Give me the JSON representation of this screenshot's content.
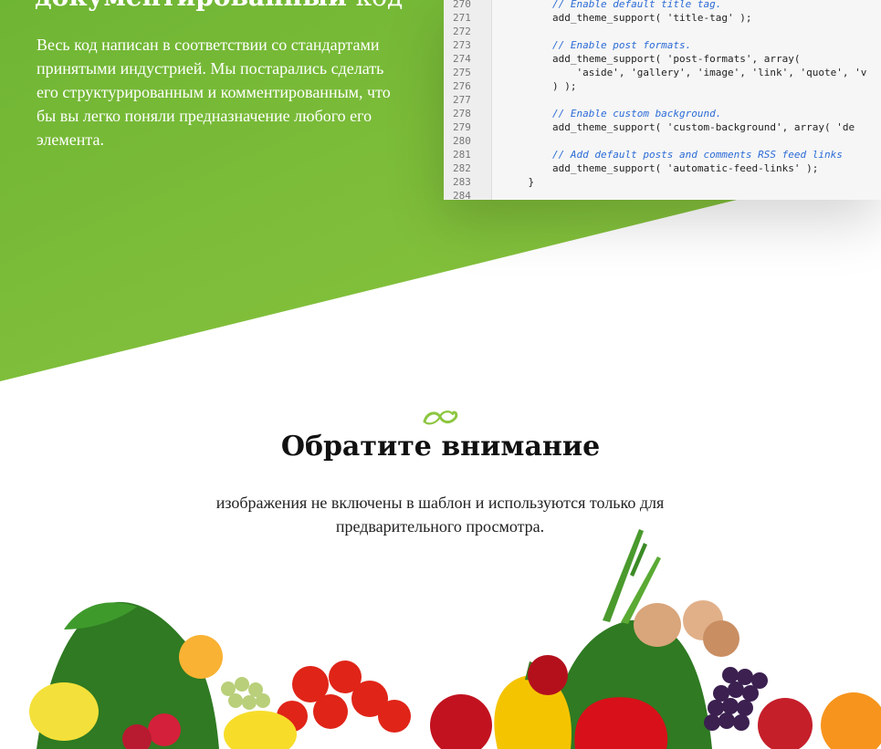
{
  "hero": {
    "title_bold": "документированный",
    "title_light": "код",
    "text": "Весь код написан в соответствии со стандартами принятыми индустрией. Мы постарались сделать его структурированным и комментированным, что бы вы легко поняли предназначение любого его элемента."
  },
  "code": {
    "lines": [
      {
        "n": "270",
        "src": "        // Enable default title tag."
      },
      {
        "n": "271",
        "src": "        add_theme_support( 'title-tag' );"
      },
      {
        "n": "272",
        "src": ""
      },
      {
        "n": "273",
        "src": "        // Enable post formats."
      },
      {
        "n": "274",
        "src": "        add_theme_support( 'post-formats', array("
      },
      {
        "n": "275",
        "src": "            'aside', 'gallery', 'image', 'link', 'quote', 'v"
      },
      {
        "n": "276",
        "src": "        ) );"
      },
      {
        "n": "277",
        "src": ""
      },
      {
        "n": "278",
        "src": "        // Enable custom background."
      },
      {
        "n": "279",
        "src": "        add_theme_support( 'custom-background', array( 'de"
      },
      {
        "n": "280",
        "src": ""
      },
      {
        "n": "281",
        "src": "        // Add default posts and comments RSS feed links"
      },
      {
        "n": "282",
        "src": "        add_theme_support( 'automatic-feed-links' );"
      },
      {
        "n": "283",
        "src": "    }"
      },
      {
        "n": "284",
        "src": ""
      }
    ]
  },
  "notice": {
    "title": "Обратите внимание",
    "text": "изображения не включены в шаблон и используются только для предварительного просмотра."
  },
  "colors": {
    "green_light": "#8cc63f",
    "green_dark": "#6ab32f",
    "ornament": "#8cc63f"
  }
}
